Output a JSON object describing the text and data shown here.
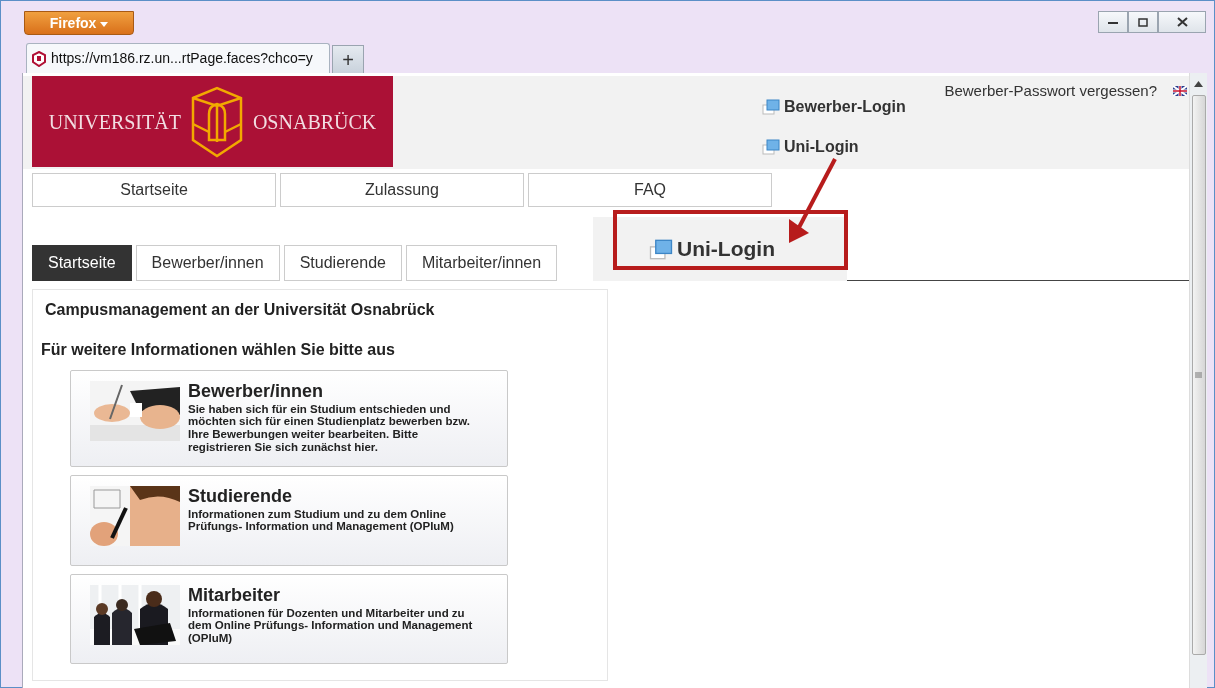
{
  "browser": {
    "menu_button": "Firefox",
    "tab_title": "https://vm186.rz.un...rtPage.faces?chco=y",
    "new_tab": "+"
  },
  "header": {
    "logo_left": "UNIVERSITÄT",
    "logo_right": "OSNABRÜCK",
    "forgot_link": "Bewerber-Passwort vergessen?",
    "login_links": [
      "Bewerber-Login",
      "Uni-Login"
    ]
  },
  "nav": [
    "Startseite",
    "Zulassung",
    "FAQ"
  ],
  "tabs": [
    {
      "label": "Startseite",
      "selected": true
    },
    {
      "label": "Bewerber/innen",
      "selected": false
    },
    {
      "label": "Studierende",
      "selected": false
    },
    {
      "label": "Mitarbeiter/innen",
      "selected": false
    }
  ],
  "login_panel": {
    "label": "Uni-Login"
  },
  "content": {
    "title": "Campusmanagement an der Universität Osnabrück",
    "subtitle": "Für weitere Informationen wählen Sie bitte aus",
    "cards": [
      {
        "title": "Bewerber/innen",
        "text": "Sie haben sich für ein Studium entschieden und möchten sich für einen Studienplatz bewerben bzw. Ihre Bewerbungen weiter bearbeiten. Bitte registrieren Sie sich zunächst hier.",
        "kind": "picture"
      },
      {
        "title": "Studierende",
        "text": "Informationen zum Studium und zu dem Online Prüfungs- Information und Management (**OPIuM**)",
        "kind": "picture"
      },
      {
        "title": "Mitarbeiter",
        "text": "Informationen für Dozenten und Mitarbeiter und zu dem Online Prüfungs- Information und Management (**OPIuM**)",
        "kind": "picture"
      }
    ]
  }
}
